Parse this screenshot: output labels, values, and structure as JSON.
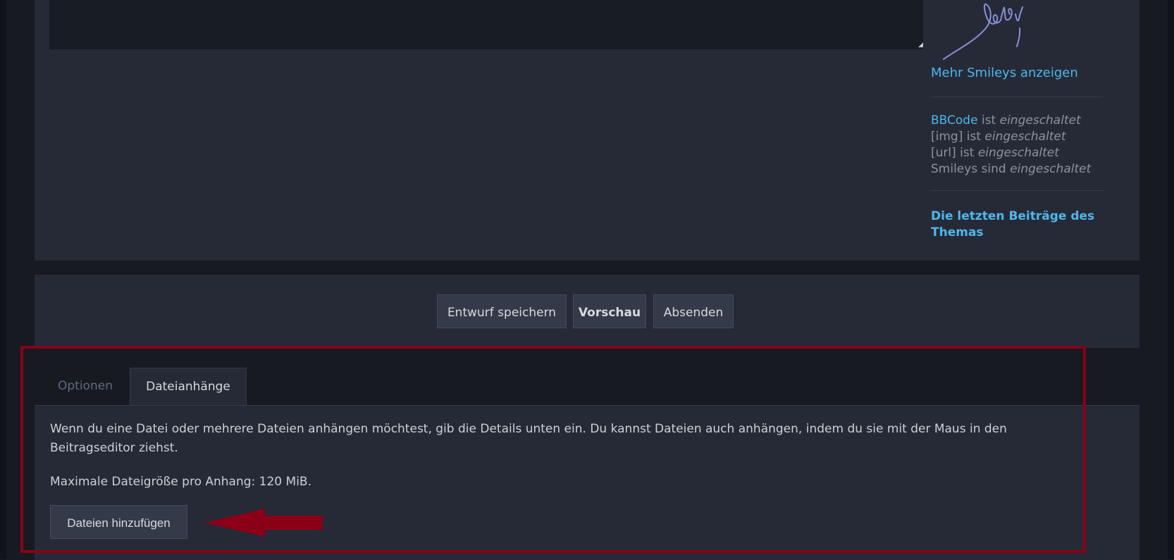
{
  "editor": {
    "resize_grip": "◢"
  },
  "sidebar": {
    "signature_text": "Baby",
    "more_smileys": "Mehr Smileys anzeigen",
    "bbcode": {
      "link": "BBCode",
      "suffix": "ist",
      "state": "eingeschaltet"
    },
    "img": {
      "prefix": "[img] ist",
      "state": "eingeschaltet"
    },
    "url": {
      "prefix": "[url] ist",
      "state": "eingeschaltet"
    },
    "smileys": {
      "prefix": "Smileys sind",
      "state": "eingeschaltet"
    },
    "latest_posts": "Die letzten Beiträge des Themas"
  },
  "actions": {
    "save_draft": "Entwurf speichern",
    "preview": "Vorschau",
    "submit": "Absenden"
  },
  "tabs": [
    {
      "label": "Optionen",
      "active": false
    },
    {
      "label": "Dateianhänge",
      "active": true
    }
  ],
  "attachments": {
    "description": "Wenn du eine Datei oder mehrere Dateien anhängen möchtest, gib die Details unten ein. Du kannst Dateien auch anhängen, indem du sie mit der Maus in den Beitragseditor ziehst.",
    "max_size": "Maximale Dateigröße pro Anhang: 120 MiB.",
    "add_files": "Dateien hinzufügen"
  },
  "colors": {
    "accent_link": "#4fb7ea",
    "highlight": "#8b0017",
    "panel": "#252a36",
    "background": "#171a21"
  },
  "icons": {
    "arrow": "left-arrow-icon",
    "resize": "resize-grip-icon"
  }
}
